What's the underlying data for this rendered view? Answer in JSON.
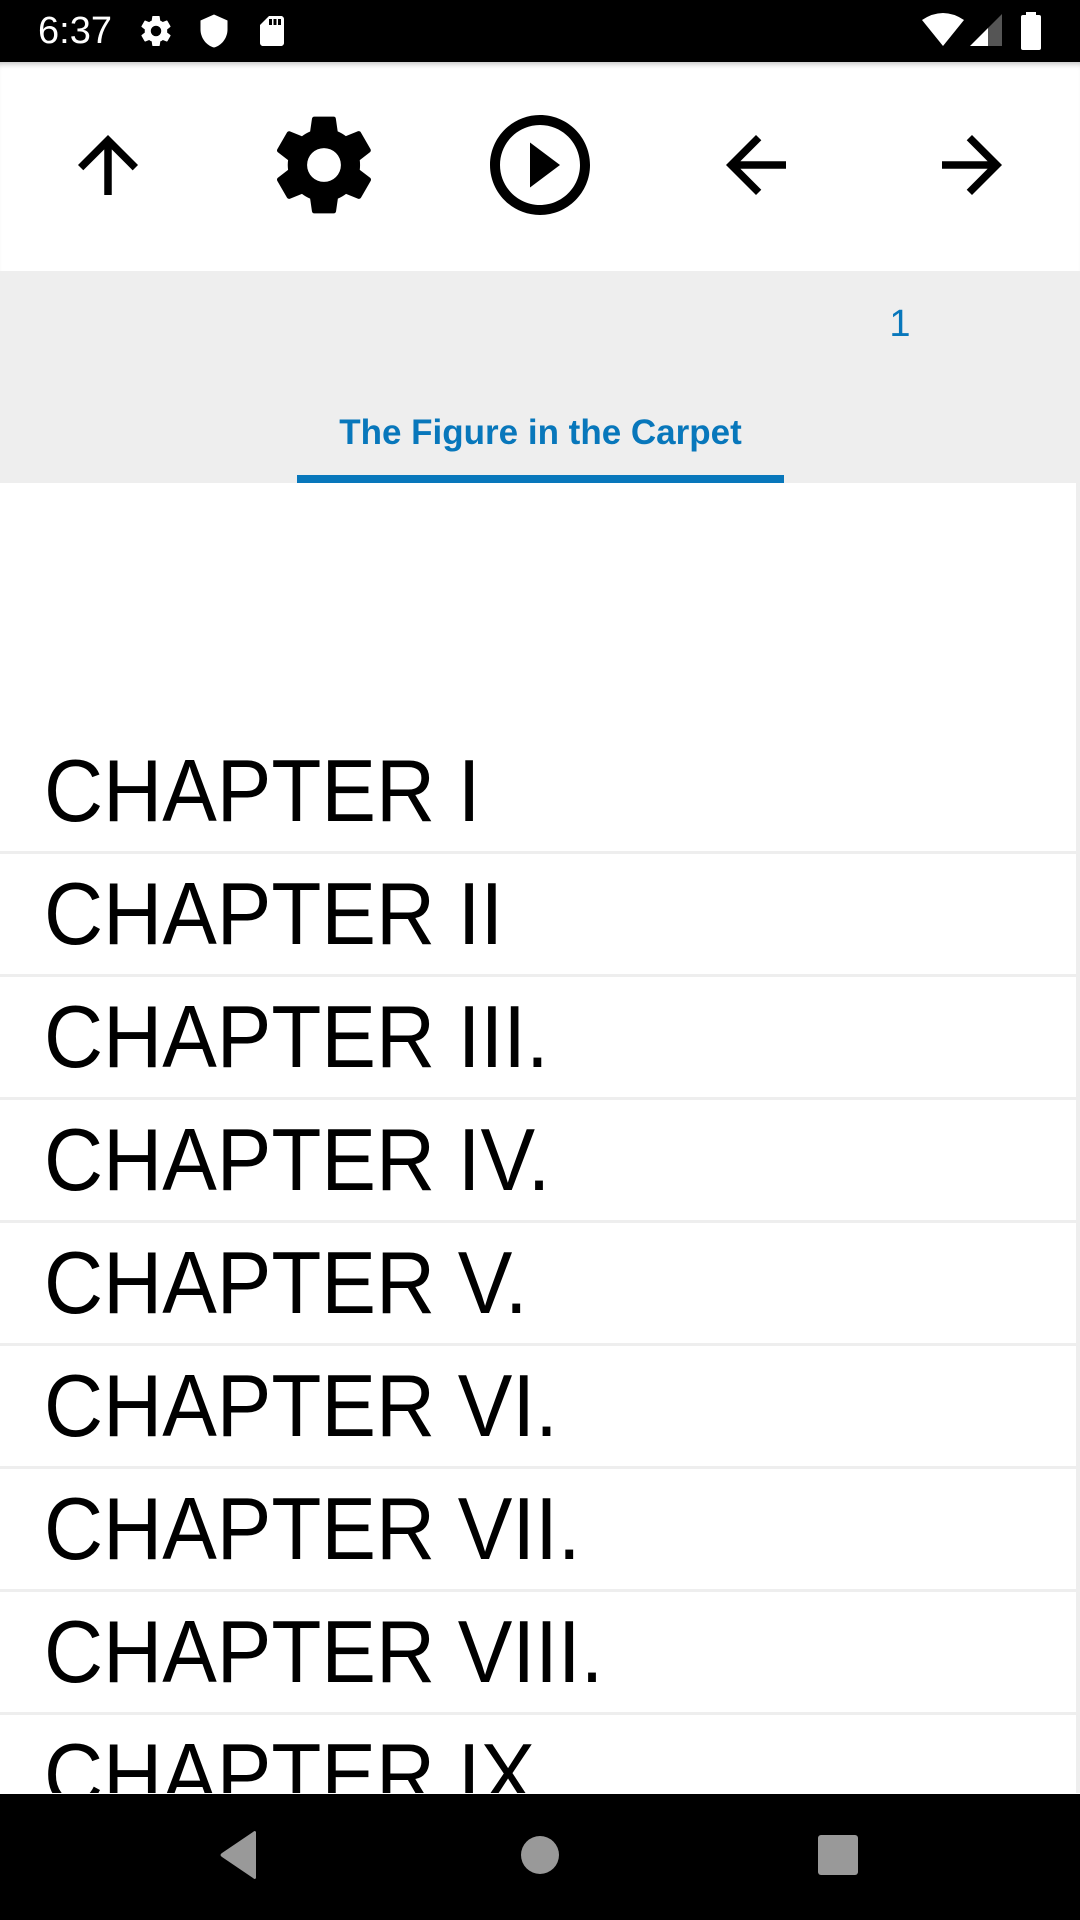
{
  "status_bar": {
    "time": "6:37",
    "left_icons": [
      "settings-icon",
      "shield-icon",
      "sd-card-icon"
    ],
    "right_icons": [
      "wifi-icon",
      "cell-signal-icon",
      "battery-icon"
    ]
  },
  "toolbar": {
    "buttons": [
      {
        "name": "up",
        "icon": "arrow-up-icon"
      },
      {
        "name": "settings",
        "icon": "gear-icon"
      },
      {
        "name": "play",
        "icon": "play-circle-icon"
      },
      {
        "name": "back",
        "icon": "arrow-left-icon"
      },
      {
        "name": "forward",
        "icon": "arrow-right-icon"
      }
    ]
  },
  "tabs": {
    "page_number": "1",
    "active_tab": "The Figure in the Carpet",
    "accent_color": "#0877bb"
  },
  "chapters": [
    "CHAPTER I",
    "CHAPTER II",
    "CHAPTER III.",
    "CHAPTER IV.",
    "CHAPTER V.",
    "CHAPTER VI.",
    "CHAPTER VII.",
    "CHAPTER VIII.",
    "CHAPTER IX."
  ],
  "nav_bar": {
    "buttons": [
      "back",
      "home",
      "recents"
    ]
  }
}
